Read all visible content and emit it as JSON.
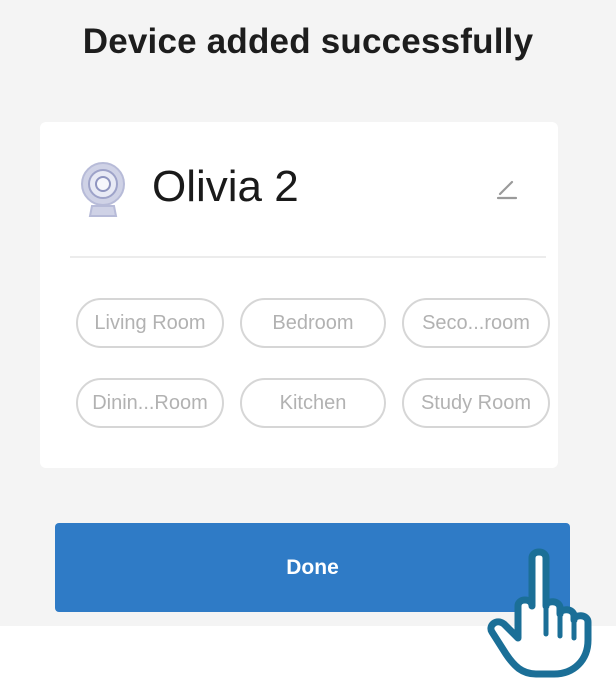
{
  "header": {
    "title": "Device added successfully"
  },
  "device": {
    "name": "Olivia 2",
    "icon": "camera-icon"
  },
  "edit": {
    "icon": "pencil-icon"
  },
  "rooms": [
    {
      "label": "Living Room"
    },
    {
      "label": "Bedroom"
    },
    {
      "label": "Seco...room"
    },
    {
      "label": "Dinin...Room"
    },
    {
      "label": "Kitchen"
    },
    {
      "label": "Study Room"
    }
  ],
  "actions": {
    "done_label": "Done"
  },
  "overlay": {
    "icon": "pointing-hand-icon"
  },
  "colors": {
    "accent": "#2f7bc6",
    "background": "#f4f4f4",
    "card": "#ffffff",
    "chip_border": "#d6d6d6",
    "chip_text": "#b2b2b2",
    "hand_outline": "#1b6f97"
  }
}
